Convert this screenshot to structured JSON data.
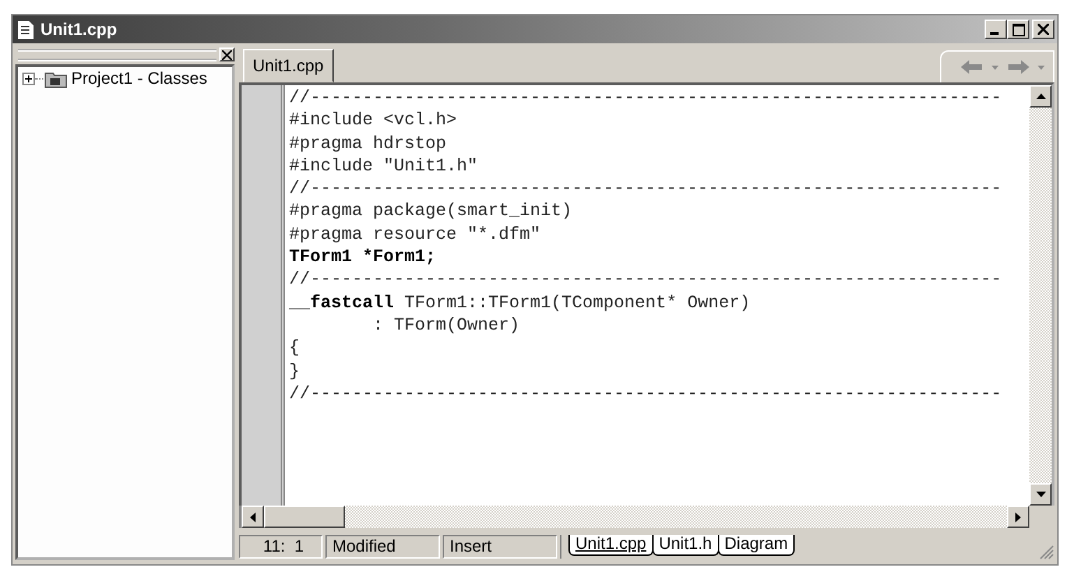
{
  "window": {
    "title": "Unit1.cpp"
  },
  "class_tree": {
    "items": [
      {
        "label": "Project1 - Classes",
        "expanded": false
      }
    ]
  },
  "editor_tabs": [
    {
      "label": "Unit1.cpp",
      "selected": true
    }
  ],
  "code_lines": [
    {
      "text": "//------------------------------------------------------------------",
      "bold": false
    },
    {
      "text": "#include <vcl.h>",
      "bold": false
    },
    {
      "text": "#pragma hdrstop",
      "bold": false
    },
    {
      "text": "#include \"Unit1.h\"",
      "bold": false
    },
    {
      "text": "//------------------------------------------------------------------",
      "bold": false
    },
    {
      "text": "#pragma package(smart_init)",
      "bold": false
    },
    {
      "text": "#pragma resource \"*.dfm\"",
      "bold": false
    },
    {
      "text": "TForm1 *Form1;",
      "bold": true
    },
    {
      "text": "//------------------------------------------------------------------",
      "bold": false
    },
    {
      "text": "__**fastcall** TForm1::TForm1(TComponent* Owner)",
      "bold": false
    },
    {
      "text": "        : TForm(Owner)",
      "bold": false
    },
    {
      "text": "{",
      "bold": false
    },
    {
      "text": "}",
      "bold": false
    },
    {
      "text": "//------------------------------------------------------------------",
      "bold": false
    }
  ],
  "status_bar": {
    "position": "11:  1",
    "modified": "Modified",
    "mode": "Insert"
  },
  "file_tabs": [
    {
      "label": "Unit1.cpp",
      "selected": true
    },
    {
      "label": "Unit1.h",
      "selected": false
    },
    {
      "label": "Diagram",
      "selected": false
    }
  ]
}
